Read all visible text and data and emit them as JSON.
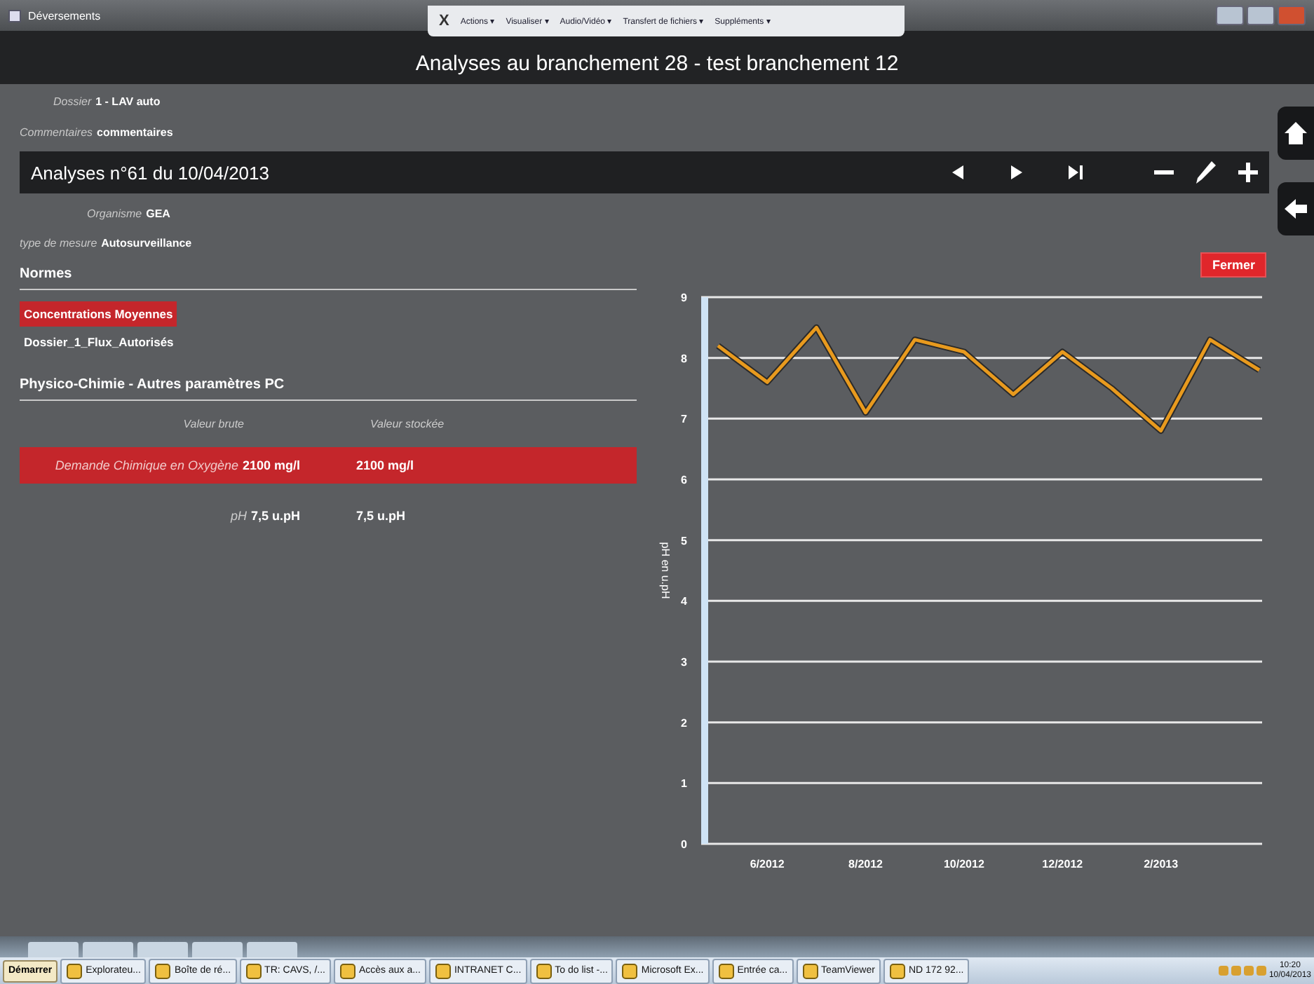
{
  "window": {
    "title": "Déversements"
  },
  "remote_toolbar": {
    "close": "X",
    "menus": [
      "Actions ▾",
      "Visualiser ▾",
      "Audio/Vidéo ▾",
      "Transfert de fichiers ▾",
      "Suppléments ▾"
    ]
  },
  "header": {
    "title": "Analyses au branchement 28 - test branchement 12"
  },
  "info": [
    {
      "label": "Dossier",
      "value": "1 - LAV auto"
    },
    {
      "label": "Commentaires",
      "value": "commentaires"
    }
  ],
  "analysis": {
    "title": "Analyses n°61 du 10/04/2013",
    "details": [
      {
        "label": "Organisme",
        "value": "GEA"
      },
      {
        "label": "type de mesure",
        "value": "Autosurveillance"
      }
    ]
  },
  "close_button": "Fermer",
  "normes": {
    "title": "Normes",
    "items": [
      {
        "label": "Concentrations Moyennes",
        "selected": true
      },
      {
        "label": "Dossier_1_Flux_Autorisés",
        "selected": false
      }
    ]
  },
  "parameters": {
    "title": "Physico-Chimie - Autres paramètres PC",
    "columns": [
      "Valeur brute",
      "Valeur stockée"
    ],
    "rows": [
      {
        "name": "Demande Chimique en Oxygène",
        "raw": "2100 mg/l",
        "stored": "2100 mg/l",
        "selected": true
      },
      {
        "name": "pH",
        "raw": "7,5 u.pH",
        "stored": "7,5 u.pH",
        "selected": false
      }
    ]
  },
  "chart_data": {
    "type": "line",
    "ylabel": "pH en u.pH",
    "categories": [
      null,
      "6/2012",
      null,
      "8/2012",
      null,
      "10/2012",
      null,
      "12/2012",
      null,
      "2/2013",
      null,
      null
    ],
    "series": [
      {
        "color": "#e89a1e",
        "values": [
          8.2,
          7.6,
          8.5,
          7.1,
          8.3,
          8.1,
          7.4,
          8.1,
          7.5,
          6.8,
          8.3,
          7.8
        ]
      }
    ],
    "grid": true,
    "ylim": [
      0,
      9
    ],
    "yticks": [
      0,
      1,
      2,
      3,
      4,
      5,
      6,
      7,
      8,
      9
    ]
  },
  "taskbar": {
    "start": "Démarrer",
    "items": [
      {
        "label": "Explorateu..."
      },
      {
        "label": "Boîte de ré..."
      },
      {
        "label": "TR: CAVS, /..."
      },
      {
        "label": "Accès aux a..."
      },
      {
        "label": "INTRANET C..."
      },
      {
        "label": "To do list -..."
      },
      {
        "label": "Microsoft Ex..."
      },
      {
        "label": "Entrée ca..."
      },
      {
        "label": "TeamViewer"
      },
      {
        "label": "ND 172 92..."
      }
    ],
    "clock": {
      "time": "10:20",
      "date": "10/04/2013"
    }
  }
}
